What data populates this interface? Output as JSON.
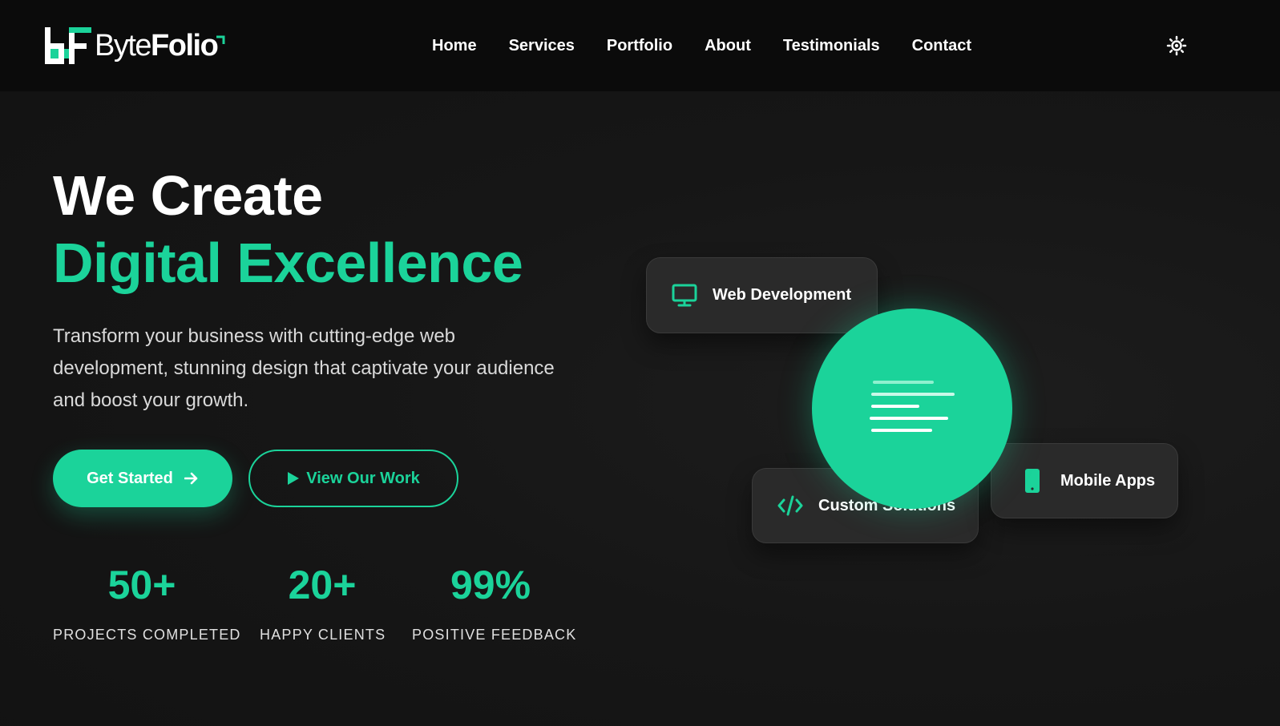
{
  "brand": {
    "logo_byte": "Byte",
    "logo_folio": "Folio",
    "accent_color": "#1bd39a",
    "background_color": "#141414"
  },
  "nav": {
    "items": [
      {
        "label": "Home"
      },
      {
        "label": "Services"
      },
      {
        "label": "Portfolio"
      },
      {
        "label": "About"
      },
      {
        "label": "Testimonials"
      },
      {
        "label": "Contact"
      }
    ],
    "theme_toggle_icon": "sun-icon"
  },
  "hero": {
    "title_line1": "We Create",
    "title_line2": "Digital Excellence",
    "description": "Transform your business with cutting-edge web development, stunning design that captivate your audience and boost your growth.",
    "primary_button": {
      "label": "Get Started",
      "icon": "arrow-right-icon"
    },
    "secondary_button": {
      "label": "View Our Work",
      "icon": "play-icon"
    }
  },
  "stats": [
    {
      "value": "50+",
      "label": "PROJECTS COMPLETED"
    },
    {
      "value": "20+",
      "label": "HAPPY CLIENTS"
    },
    {
      "value": "99%",
      "label": "POSITIVE FEEDBACK"
    }
  ],
  "services_visual": {
    "cards": [
      {
        "label": "Web Development",
        "icon": "monitor-icon"
      },
      {
        "label": "Custom Solutions",
        "icon": "code-icon"
      },
      {
        "label": "Mobile Apps",
        "icon": "smartphone-icon"
      }
    ],
    "center_icon": "text-lines-icon"
  }
}
